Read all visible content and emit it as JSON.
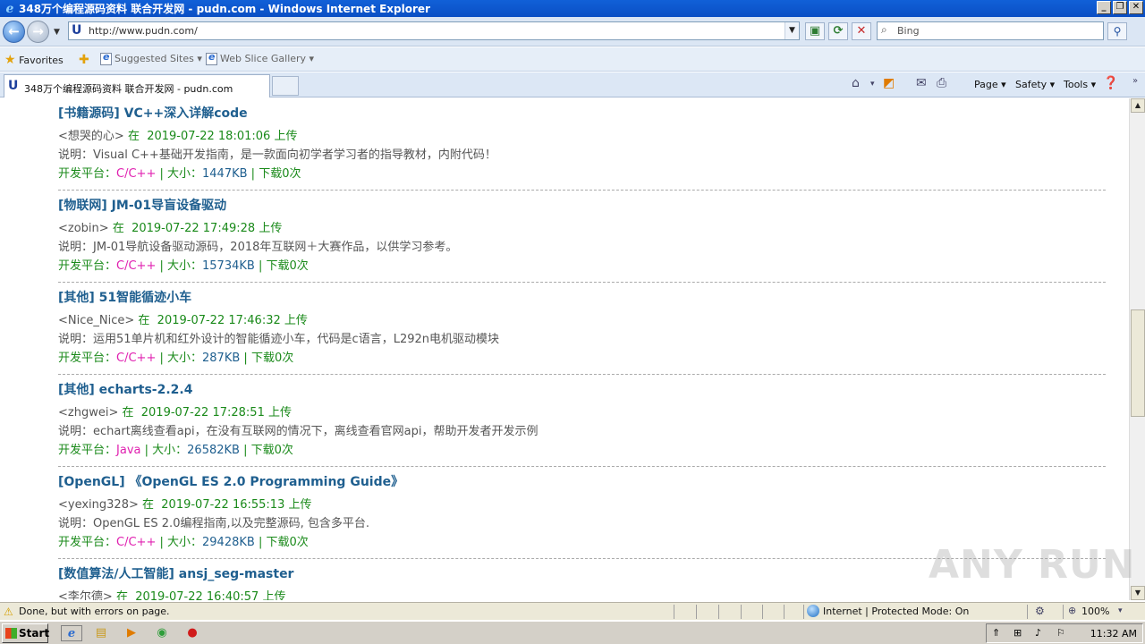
{
  "window": {
    "title": "348万个编程源码资料 联合开发网 - pudn.com - Windows Internet Explorer"
  },
  "address_bar": {
    "url": "http://www.pudn.com/"
  },
  "search": {
    "placeholder": "Bing"
  },
  "favorites_bar": {
    "favorites_label": "Favorites",
    "items": [
      "Suggested Sites ▾",
      "Web Slice Gallery ▾"
    ]
  },
  "tabs": [
    {
      "label": "348万个编程源码资料 联合开发网 - pudn.com"
    }
  ],
  "command_bar": {
    "page": "Page ▾",
    "safety": "Safety ▾",
    "tools": "Tools ▾"
  },
  "listing": {
    "platform_label": "开发平台：",
    "size_label": "大小：",
    "downloads_label": "下载",
    "uploaded_label": "上传",
    "at_label": "在",
    "desc_label": "说明：",
    "entries": [
      {
        "category": "[书籍源码]",
        "name": "VC++深入详解code",
        "author": "<想哭的心>",
        "datetime": "2019-07-22 18:01:06",
        "description": "Visual C++基础开发指南，是一款面向初学者学习者的指导教材，内附代码！",
        "platform": "C/C++",
        "size": "1447KB",
        "downloads": "0次"
      },
      {
        "category": "[物联网]",
        "name": "JM-01导盲设备驱动",
        "author": "<zobin>",
        "datetime": "2019-07-22 17:49:28",
        "description": "JM-01导航设备驱动源码，2018年互联网＋大赛作品，以供学习参考。",
        "platform": "C/C++",
        "size": "15734KB",
        "downloads": "0次"
      },
      {
        "category": "[其他]",
        "name": "51智能循迹小车",
        "author": "<Nice_Nice>",
        "datetime": "2019-07-22 17:46:32",
        "description": "运用51单片机和红外设计的智能循迹小车，代码是c语言，L292n电机驱动模块",
        "platform": "C/C++",
        "size": "287KB",
        "downloads": "0次"
      },
      {
        "category": "[其他]",
        "name": "echarts-2.2.4",
        "author": "<zhgwei>",
        "datetime": "2019-07-22 17:28:51",
        "description": "echart离线查看api，在没有互联网的情况下，离线查看官网api，帮助开发者开发示例",
        "platform": "Java",
        "size": "26582KB",
        "downloads": "0次"
      },
      {
        "category": "[OpenGL]",
        "name": "《OpenGL ES 2.0 Programming Guide》",
        "author": "<yexing328>",
        "datetime": "2019-07-22 16:55:13",
        "description": "OpenGL ES 2.0编程指南,以及完整源码, 包含多平台.",
        "platform": "C/C++",
        "size": "29428KB",
        "downloads": "0次"
      },
      {
        "category": "[数值算法/人工智能]",
        "name": "ansj_seg-master",
        "author": "<李尔德>",
        "datetime": "2019-07-22 16:40:57",
        "description": "",
        "platform": "",
        "size": "",
        "downloads": ""
      }
    ]
  },
  "status_bar": {
    "message": "Done, but with errors on page.",
    "zone": "Internet | Protected Mode: On",
    "zoom": "100%"
  },
  "taskbar": {
    "start_label": "Start",
    "clock": "11:32 AM"
  },
  "watermark": "ANY RUN"
}
